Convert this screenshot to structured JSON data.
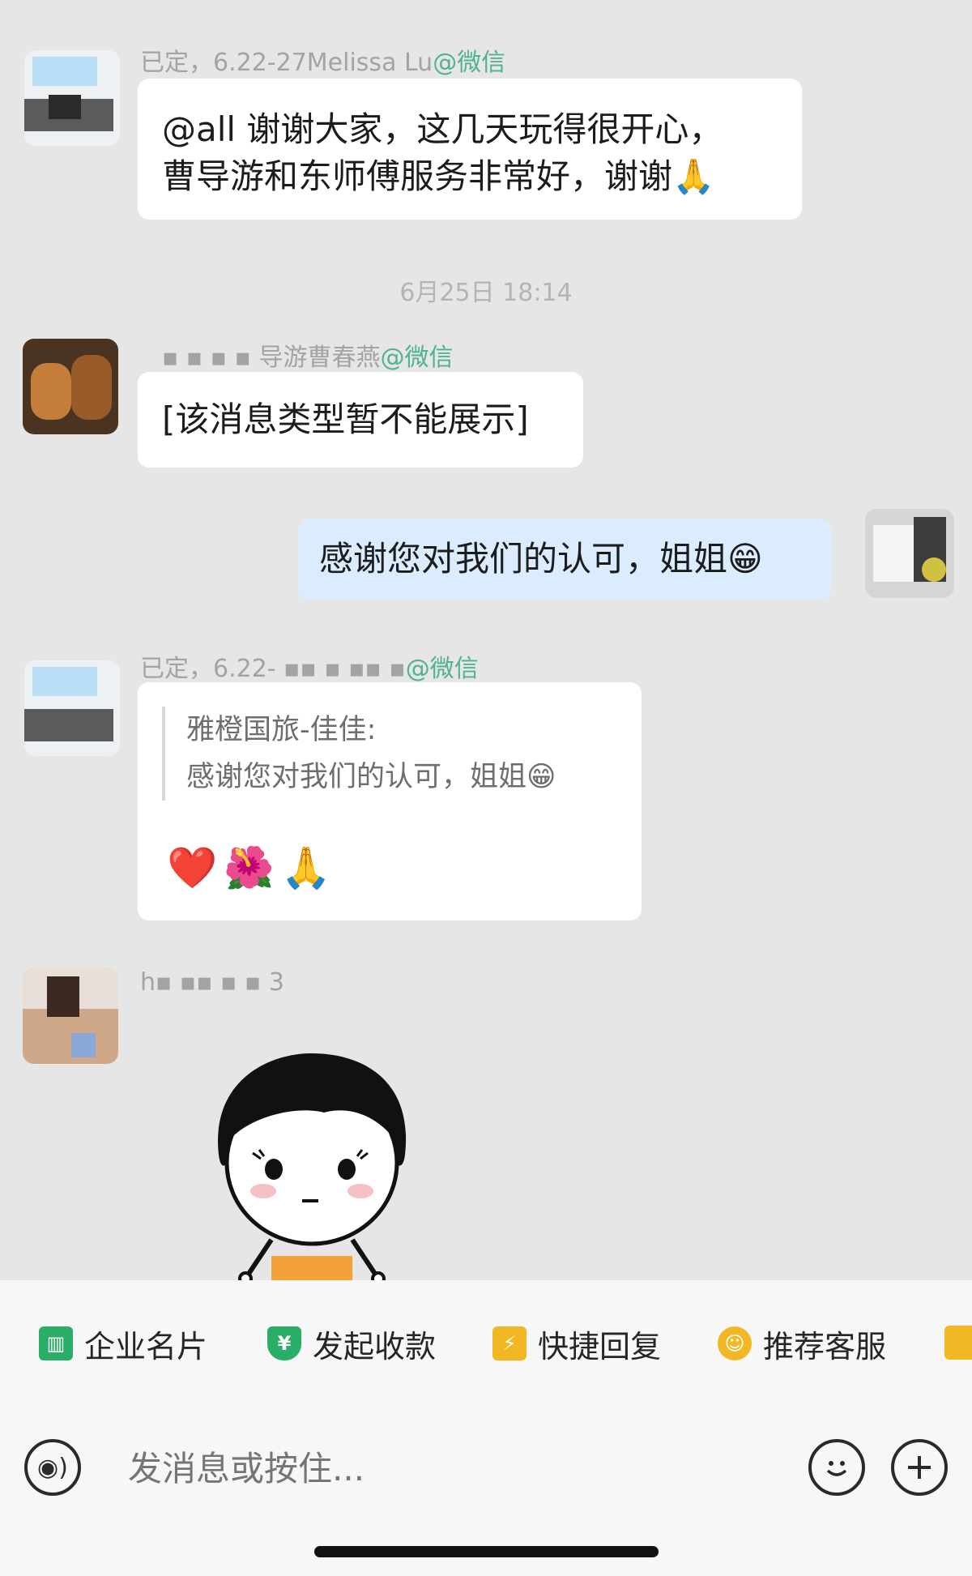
{
  "messages": {
    "m1": {
      "sender_prefix": "已定，6.22-27Melissa Lu",
      "sender_suffix": "@微信",
      "text_line1": "@all 谢谢大家，这几天玩得很开心，",
      "text_line2": "曹导游和东师傅服务非常好，谢谢",
      "emoji": "🙏"
    },
    "timestamp": "6月25日 18:14",
    "m2": {
      "sender_prefix": "▪ ▪ ▪ ▪  导游曹春燕",
      "sender_suffix": "@微信",
      "text": "[该消息类型暂不能展示]"
    },
    "m3": {
      "text": "感谢您对我们的认可，姐姐",
      "emoji": "😁"
    },
    "m4": {
      "sender_prefix": "已定，6.22- ▪▪  ▪  ▪▪ ▪",
      "sender_suffix": "@微信",
      "quote_author": "雅橙国旅-佳佳:",
      "quote_text": "感谢您对我们的认可，姐姐😁",
      "reactions": "❤️🌺🙏"
    },
    "m5": {
      "sender_prefix": "h▪  ▪▪  ▪  ▪  3"
    }
  },
  "toolbar": {
    "quick_actions": [
      {
        "label": "企业名片",
        "icon": "business-card-icon",
        "color": "#2aae67"
      },
      {
        "label": "发起收款",
        "icon": "payment-icon",
        "color": "#2aae67"
      },
      {
        "label": "快捷回复",
        "icon": "quick-reply-icon",
        "color": "#f2b824"
      },
      {
        "label": "推荐客服",
        "icon": "recommend-service-icon",
        "color": "#f2b824"
      }
    ],
    "input_placeholder": "发消息或按住..."
  }
}
